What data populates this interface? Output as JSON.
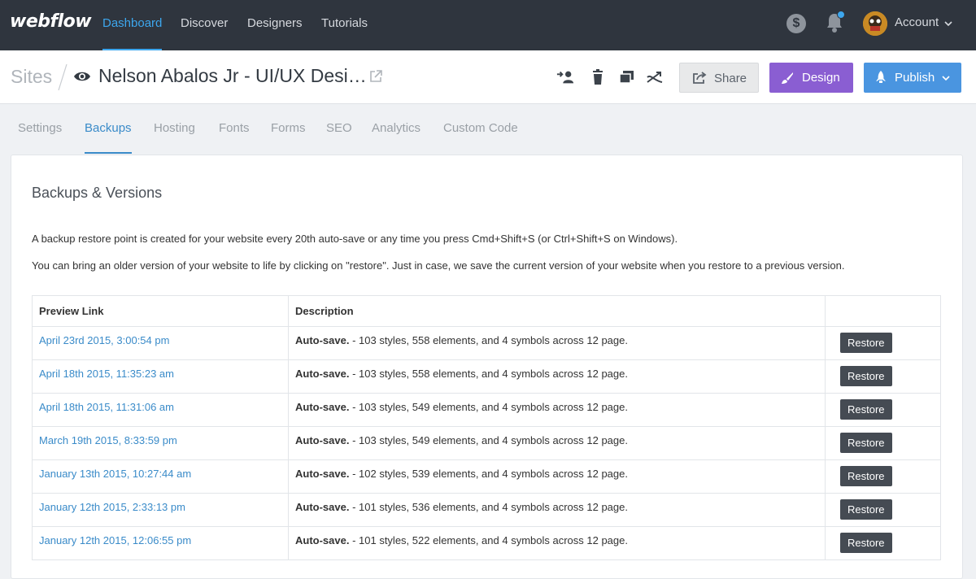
{
  "topnav": {
    "logo": "webflow",
    "links": [
      "Dashboard",
      "Discover",
      "Designers",
      "Tutorials"
    ],
    "account_label": "Account"
  },
  "siteheader": {
    "sites_label": "Sites",
    "site_title": "Nelson Abalos Jr - UI/UX Desi…",
    "share_label": "Share",
    "design_label": "Design",
    "publish_label": "Publish"
  },
  "tabs": [
    "Settings",
    "Backups",
    "Hosting",
    "Fonts",
    "Forms",
    "SEO",
    "Analytics",
    "Custom Code"
  ],
  "panel": {
    "title": "Backups & Versions",
    "para1": "A backup restore point is created for your website every 20th auto-save or any time you press Cmd+Shift+S (or Ctrl+Shift+S on Windows).",
    "para2": "You can bring an older version of your website to life by clicking on \"restore\". Just in case, we save the current version of your website when you restore to a previous version.",
    "columns": [
      "Preview Link",
      "Description",
      ""
    ],
    "rows": [
      {
        "link": "April 23rd 2015, 3:00:54 pm",
        "type": "Auto-save.",
        "desc": " - 103 styles, 558 elements, and 4 symbols across 12 page.",
        "action": "Restore"
      },
      {
        "link": "April 18th 2015, 11:35:23 am",
        "type": "Auto-save.",
        "desc": " - 103 styles, 558 elements, and 4 symbols across 12 page.",
        "action": "Restore"
      },
      {
        "link": "April 18th 2015, 11:31:06 am",
        "type": "Auto-save.",
        "desc": " - 103 styles, 549 elements, and 4 symbols across 12 page.",
        "action": "Restore"
      },
      {
        "link": "March 19th 2015, 8:33:59 pm",
        "type": "Auto-save.",
        "desc": " - 103 styles, 549 elements, and 4 symbols across 12 page.",
        "action": "Restore"
      },
      {
        "link": "January 13th 2015, 10:27:44 am",
        "type": "Auto-save.",
        "desc": " - 102 styles, 539 elements, and 4 symbols across 12 page.",
        "action": "Restore"
      },
      {
        "link": "January 12th 2015, 2:33:13 pm",
        "type": "Auto-save.",
        "desc": " - 101 styles, 536 elements, and 4 symbols across 12 page.",
        "action": "Restore"
      },
      {
        "link": "January 12th 2015, 12:06:55 pm",
        "type": "Auto-save.",
        "desc": " - 101 styles, 522 elements, and 4 symbols across 12 page.",
        "action": "Restore"
      }
    ]
  },
  "colors": {
    "nav_bg": "#2f353e",
    "accent_blue": "#3da7ee",
    "design_purple": "#8a5ed2",
    "publish_blue": "#4a95e0",
    "restore_dark": "#454b53"
  },
  "icons": [
    "dollar-icon",
    "bell-icon",
    "chevron-down-icon",
    "eye-icon",
    "external-link-icon",
    "add-collaborator-icon",
    "trash-icon",
    "duplicate-icon",
    "transfer-icon",
    "share-icon",
    "brush-icon",
    "rocket-icon"
  ]
}
